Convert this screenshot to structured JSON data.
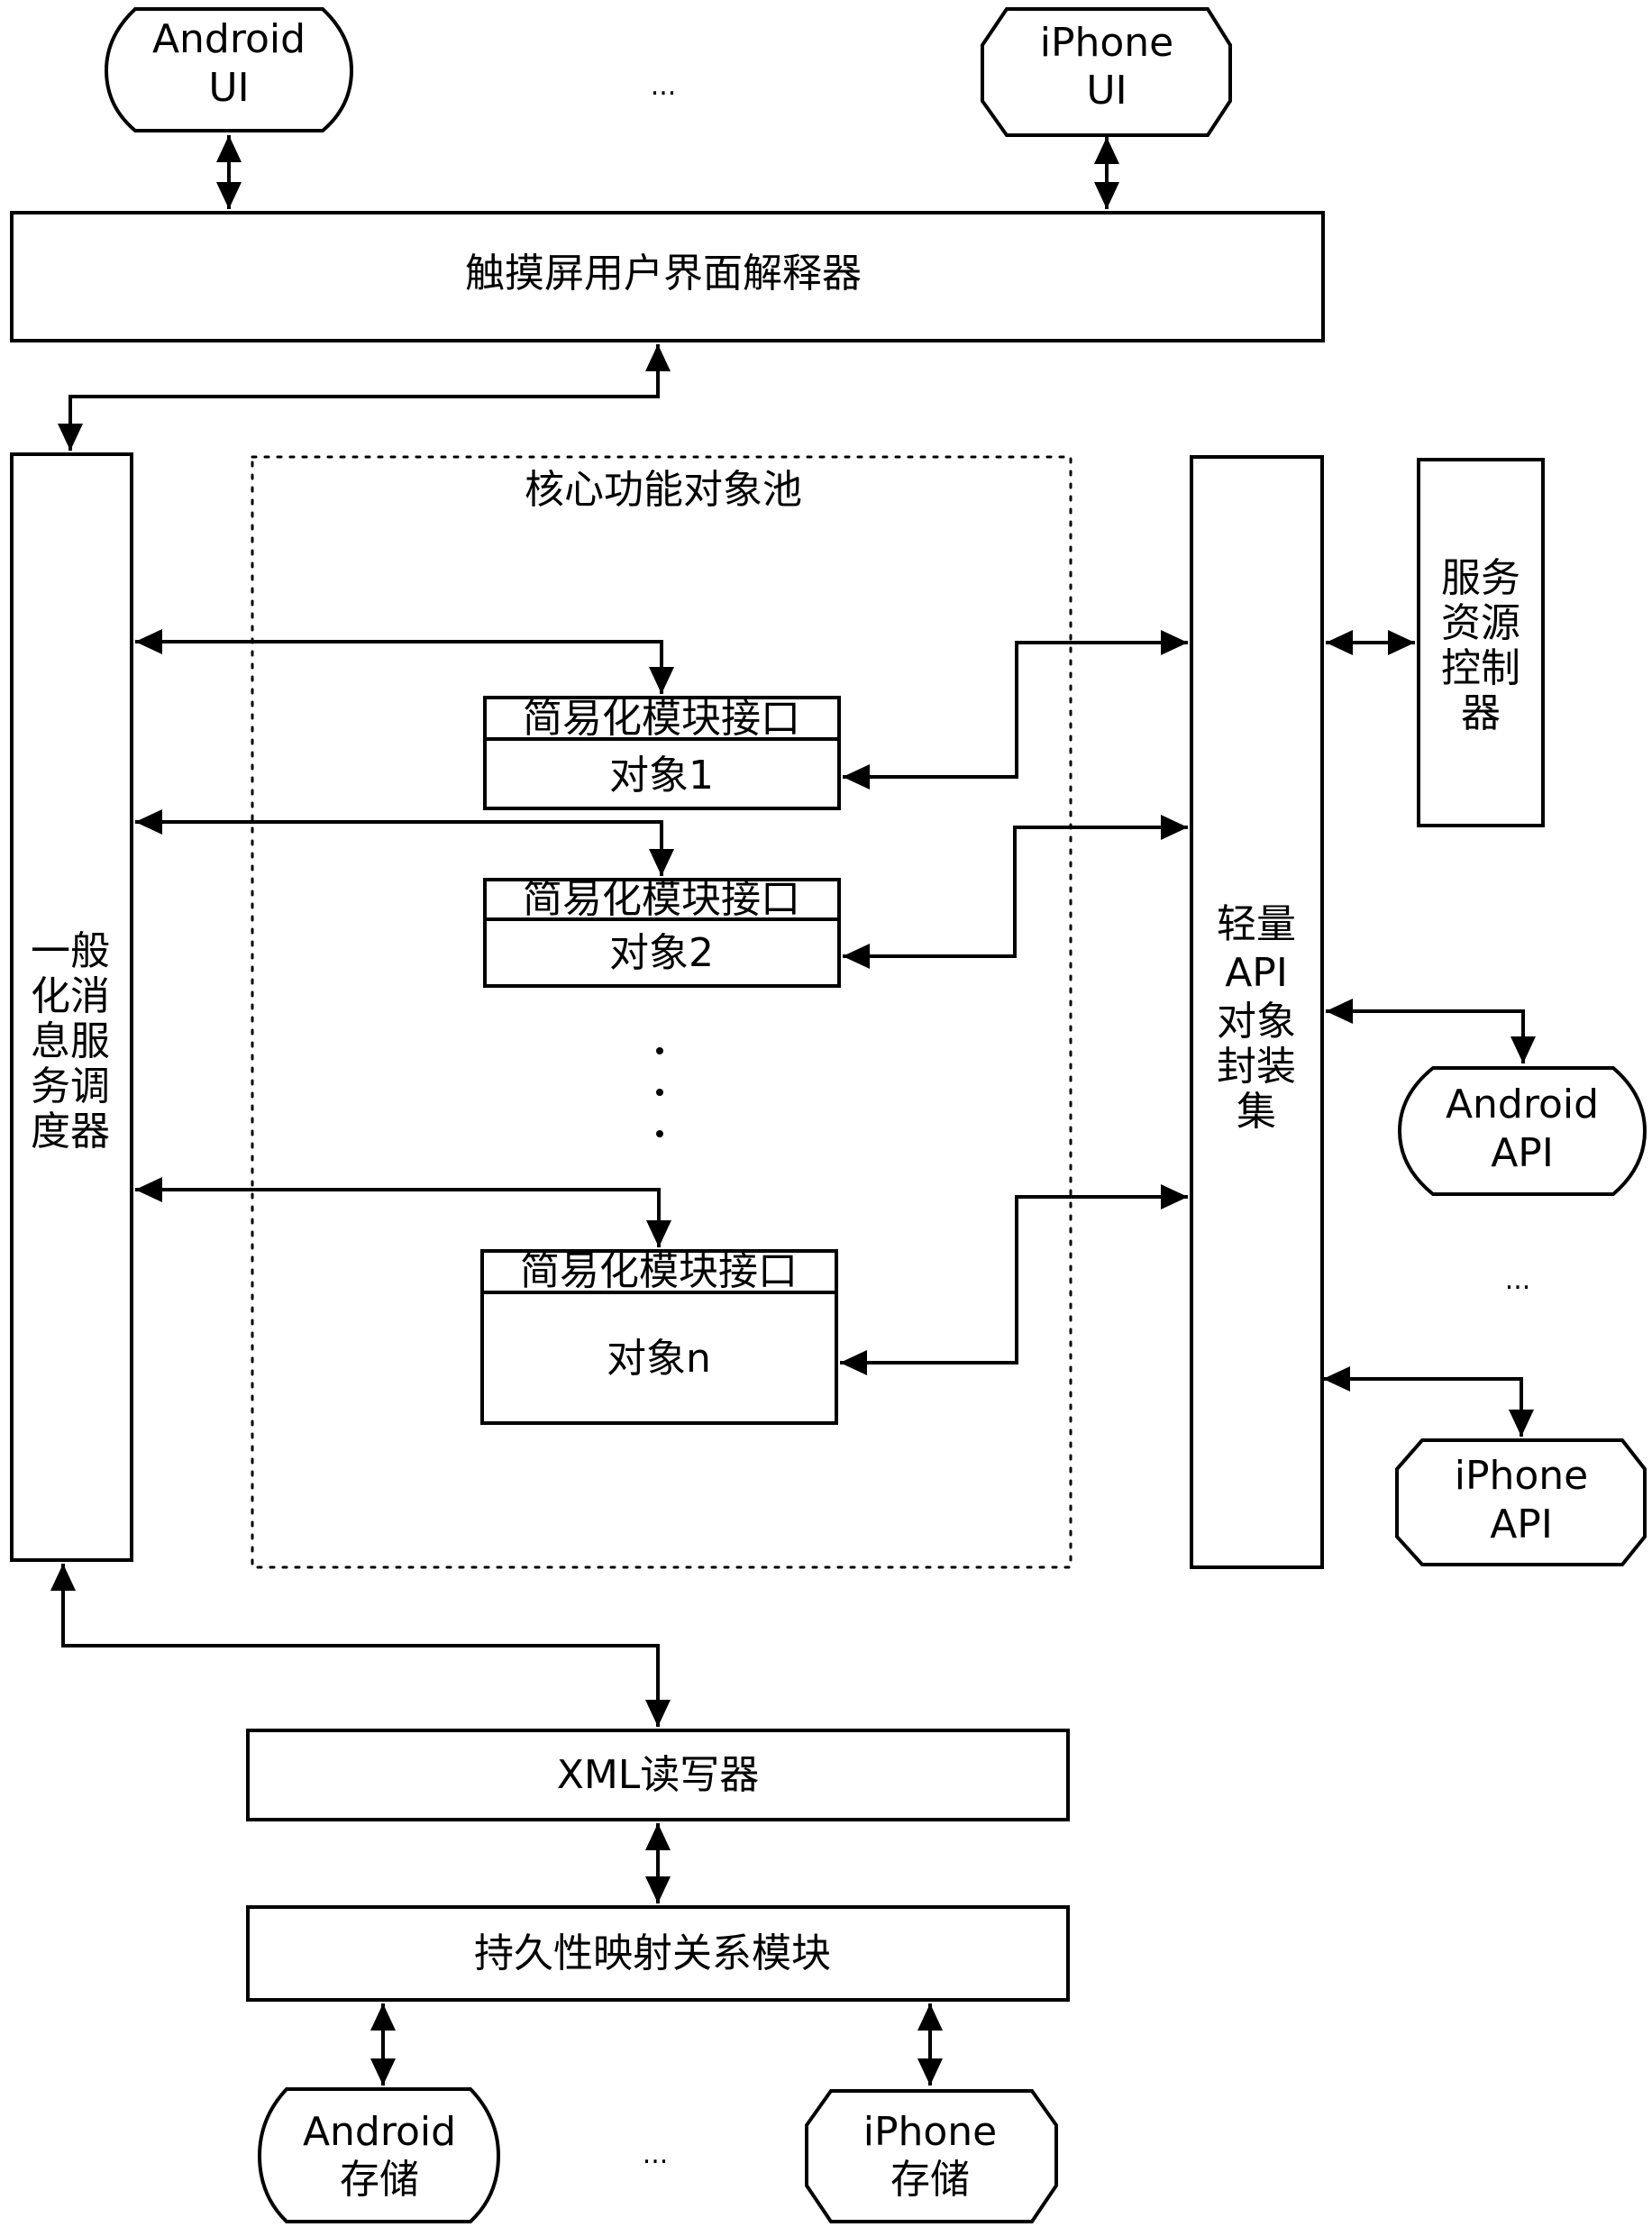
{
  "diagram": {
    "top_clients": {
      "android_ui": [
        "Android",
        "UI"
      ],
      "ellipsis": "...",
      "iphone_ui": [
        "iPhone",
        "UI"
      ]
    },
    "touch_interpreter": "触摸屏用户界面解释器",
    "message_dispatcher": [
      "一般",
      "化消",
      "息服",
      "务调",
      "度器"
    ],
    "core_pool": {
      "title": "核心功能对象池",
      "objects": [
        {
          "interface": "简易化模块接口",
          "name": "对象1"
        },
        {
          "interface": "简易化模块接口",
          "name": "对象2"
        },
        {
          "interface": "简易化模块接口",
          "name": "对象n"
        }
      ],
      "vertical_ellipsis": "..."
    },
    "api_wrapper": [
      "轻量",
      "API",
      "对象",
      "封装",
      "集"
    ],
    "service_controller": [
      "服务",
      "资源",
      "控制",
      "器"
    ],
    "platform_apis": {
      "android_api": [
        "Android",
        "API"
      ],
      "ellipsis": "...",
      "iphone_api": [
        "iPhone",
        "API"
      ]
    },
    "xml_rw": "XML读写器",
    "persistence": "持久性映射关系模块",
    "storage": {
      "android_storage": [
        "Android",
        "存储"
      ],
      "ellipsis": "...",
      "iphone_storage": [
        "iPhone",
        "存储"
      ]
    }
  }
}
